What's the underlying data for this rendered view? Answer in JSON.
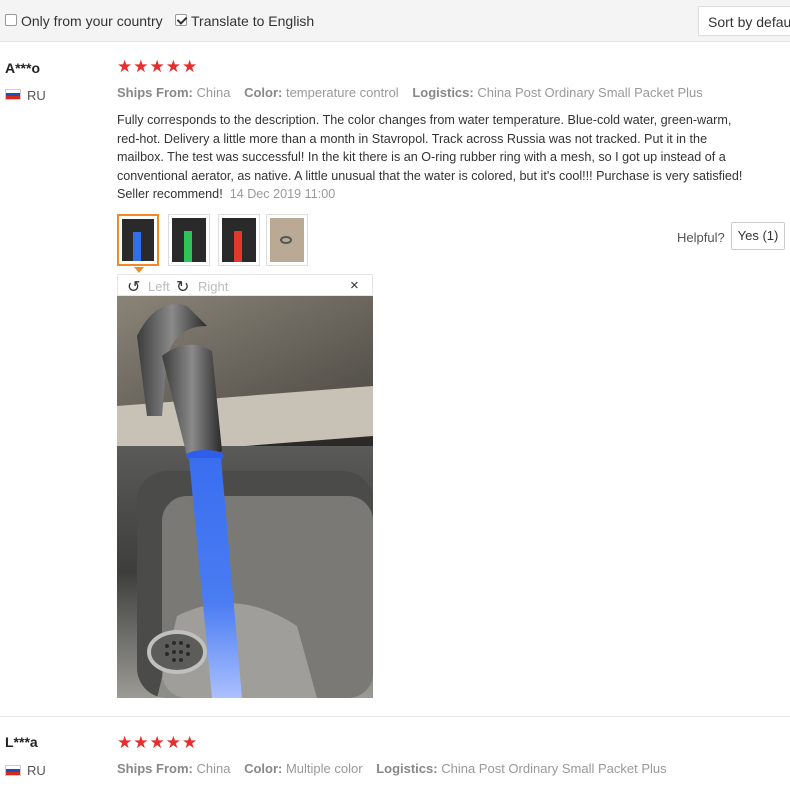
{
  "filters": {
    "only_country": {
      "label": "Only from your country",
      "checked": false
    },
    "translate": {
      "label": "Translate to English",
      "checked": true
    },
    "sort_label": "Sort by default"
  },
  "reviews": [
    {
      "user": "A***o",
      "country": "RU",
      "rating": 5,
      "stars": "★★★★★",
      "ships_from_label": "Ships From:",
      "ships_from": "China",
      "color_label": "Color:",
      "color": "temperature control",
      "logistics_label": "Logistics:",
      "logistics": "China Post Ordinary Small Packet Plus",
      "text": "Fully corresponds to the description. The color changes from water temperature. Blue-cold water, green-warm, red-hot. Delivery a little more than a month in Stavropol. Track across Russia was not tracked. Put it in the mailbox. The test was successful! In the kit there is an O-ring rubber ring with a mesh, so I got up instead of a conventional aerator, as native. A little unusual that the water is colored, but it's cool!!! Purchase is very satisfied! Seller recommend!",
      "date": "14 Dec 2019 11:00",
      "helpful_label": "Helpful?",
      "yes_label": "Yes (1)",
      "viewer": {
        "left_label": "Left",
        "right_label": "Right",
        "close": "×"
      }
    },
    {
      "user": "L***a",
      "country": "RU",
      "rating": 5,
      "stars": "★★★★★",
      "ships_from_label": "Ships From:",
      "ships_from": "China",
      "color_label": "Color:",
      "color": "Multiple color",
      "logistics_label": "Logistics:",
      "logistics": "China Post Ordinary Small Packet Plus"
    }
  ],
  "colors": {
    "star": "#e62e2e",
    "accent_border": "#f08a24",
    "muted": "#888888"
  },
  "icons": {
    "rotate_left": "↺",
    "rotate_right": "↻"
  }
}
